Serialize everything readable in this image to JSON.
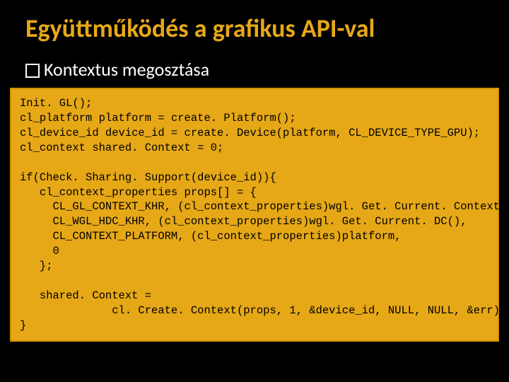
{
  "title": "Együttműködés a grafikus API-val",
  "subtitle": "Kontextus megosztása",
  "code": "Init. GL();\ncl_platform platform = create. Platform();\ncl_device_id device_id = create. Device(platform, CL_DEVICE_TYPE_GPU);\ncl_context shared. Context = 0;\n\nif(Check. Sharing. Support(device_id)){\n   cl_context_properties props[] = {\n     CL_GL_CONTEXT_KHR, (cl_context_properties)wgl. Get. Current. Context(),\n     CL_WGL_HDC_KHR, (cl_context_properties)wgl. Get. Current. DC(),\n     CL_CONTEXT_PLATFORM, (cl_context_properties)platform,\n     0\n   };\n\n   shared. Context =\n              cl. Create. Context(props, 1, &device_id, NULL, NULL, &err);\n}"
}
